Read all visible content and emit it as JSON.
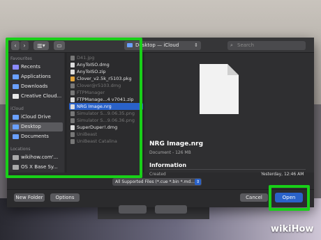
{
  "toolbar": {
    "location": "Desktop — iCloud",
    "search_placeholder": "Search"
  },
  "sidebar": {
    "favorites_header": "Favourites",
    "icloud_header": "iCloud",
    "locations_header": "Locations",
    "favorites": [
      {
        "label": "Recents",
        "color": "#8b8bff"
      },
      {
        "label": "Applications",
        "color": "#6aa0ff"
      },
      {
        "label": "Downloads",
        "color": "#6aa0ff"
      },
      {
        "label": "Creative Cloud...",
        "color": "#e8e8e8"
      }
    ],
    "icloud": [
      {
        "label": "iCloud Drive",
        "color": "#6aa0ff"
      },
      {
        "label": "Desktop",
        "color": "#6aa0ff"
      },
      {
        "label": "Documents",
        "color": "#6aa0ff"
      }
    ],
    "locations": [
      {
        "label": "wikihow.com'...",
        "color": "#aaaaaa"
      },
      {
        "label": "OS X Base Sy...",
        "color": "#aaaaaa"
      }
    ]
  },
  "files": [
    {
      "name": "D41.jpg",
      "dim": true
    },
    {
      "name": "AnyToISO.dmg",
      "dim": false
    },
    {
      "name": "AnyToISO.zip",
      "dim": false
    },
    {
      "name": "Clover_v2.5k_r5103.pkg",
      "dim": false
    },
    {
      "name": "Clover@r5103.dmg",
      "dim": true
    },
    {
      "name": "FTPManager",
      "dim": true
    },
    {
      "name": "FTPManage...4 v7041.zip",
      "dim": false
    },
    {
      "name": "NRG Image.nrg",
      "dim": false,
      "selected": true
    },
    {
      "name": "Simulator S...9.06.35.png",
      "dim": true
    },
    {
      "name": "Simulator S...9.06.36.png",
      "dim": true
    },
    {
      "name": "SuperDuper!.dmg",
      "dim": false
    },
    {
      "name": "UniBeast",
      "dim": true
    },
    {
      "name": "UniBeast Catalina",
      "dim": true
    }
  ],
  "preview": {
    "name": "NRG Image.nrg",
    "meta": "Document - 126 MB",
    "info_header": "Information",
    "created_label": "Created",
    "created_value": "Yesterday, 12:46 AM"
  },
  "format_filter": "All Supported Files (*.cue *.bin *.md...",
  "buttons": {
    "new_folder": "New Folder",
    "options": "Options",
    "cancel": "Cancel",
    "open": "Open"
  },
  "watermark": "wikiHow",
  "colors": {
    "highlight": "#18d018",
    "accent": "#2a62c9"
  }
}
